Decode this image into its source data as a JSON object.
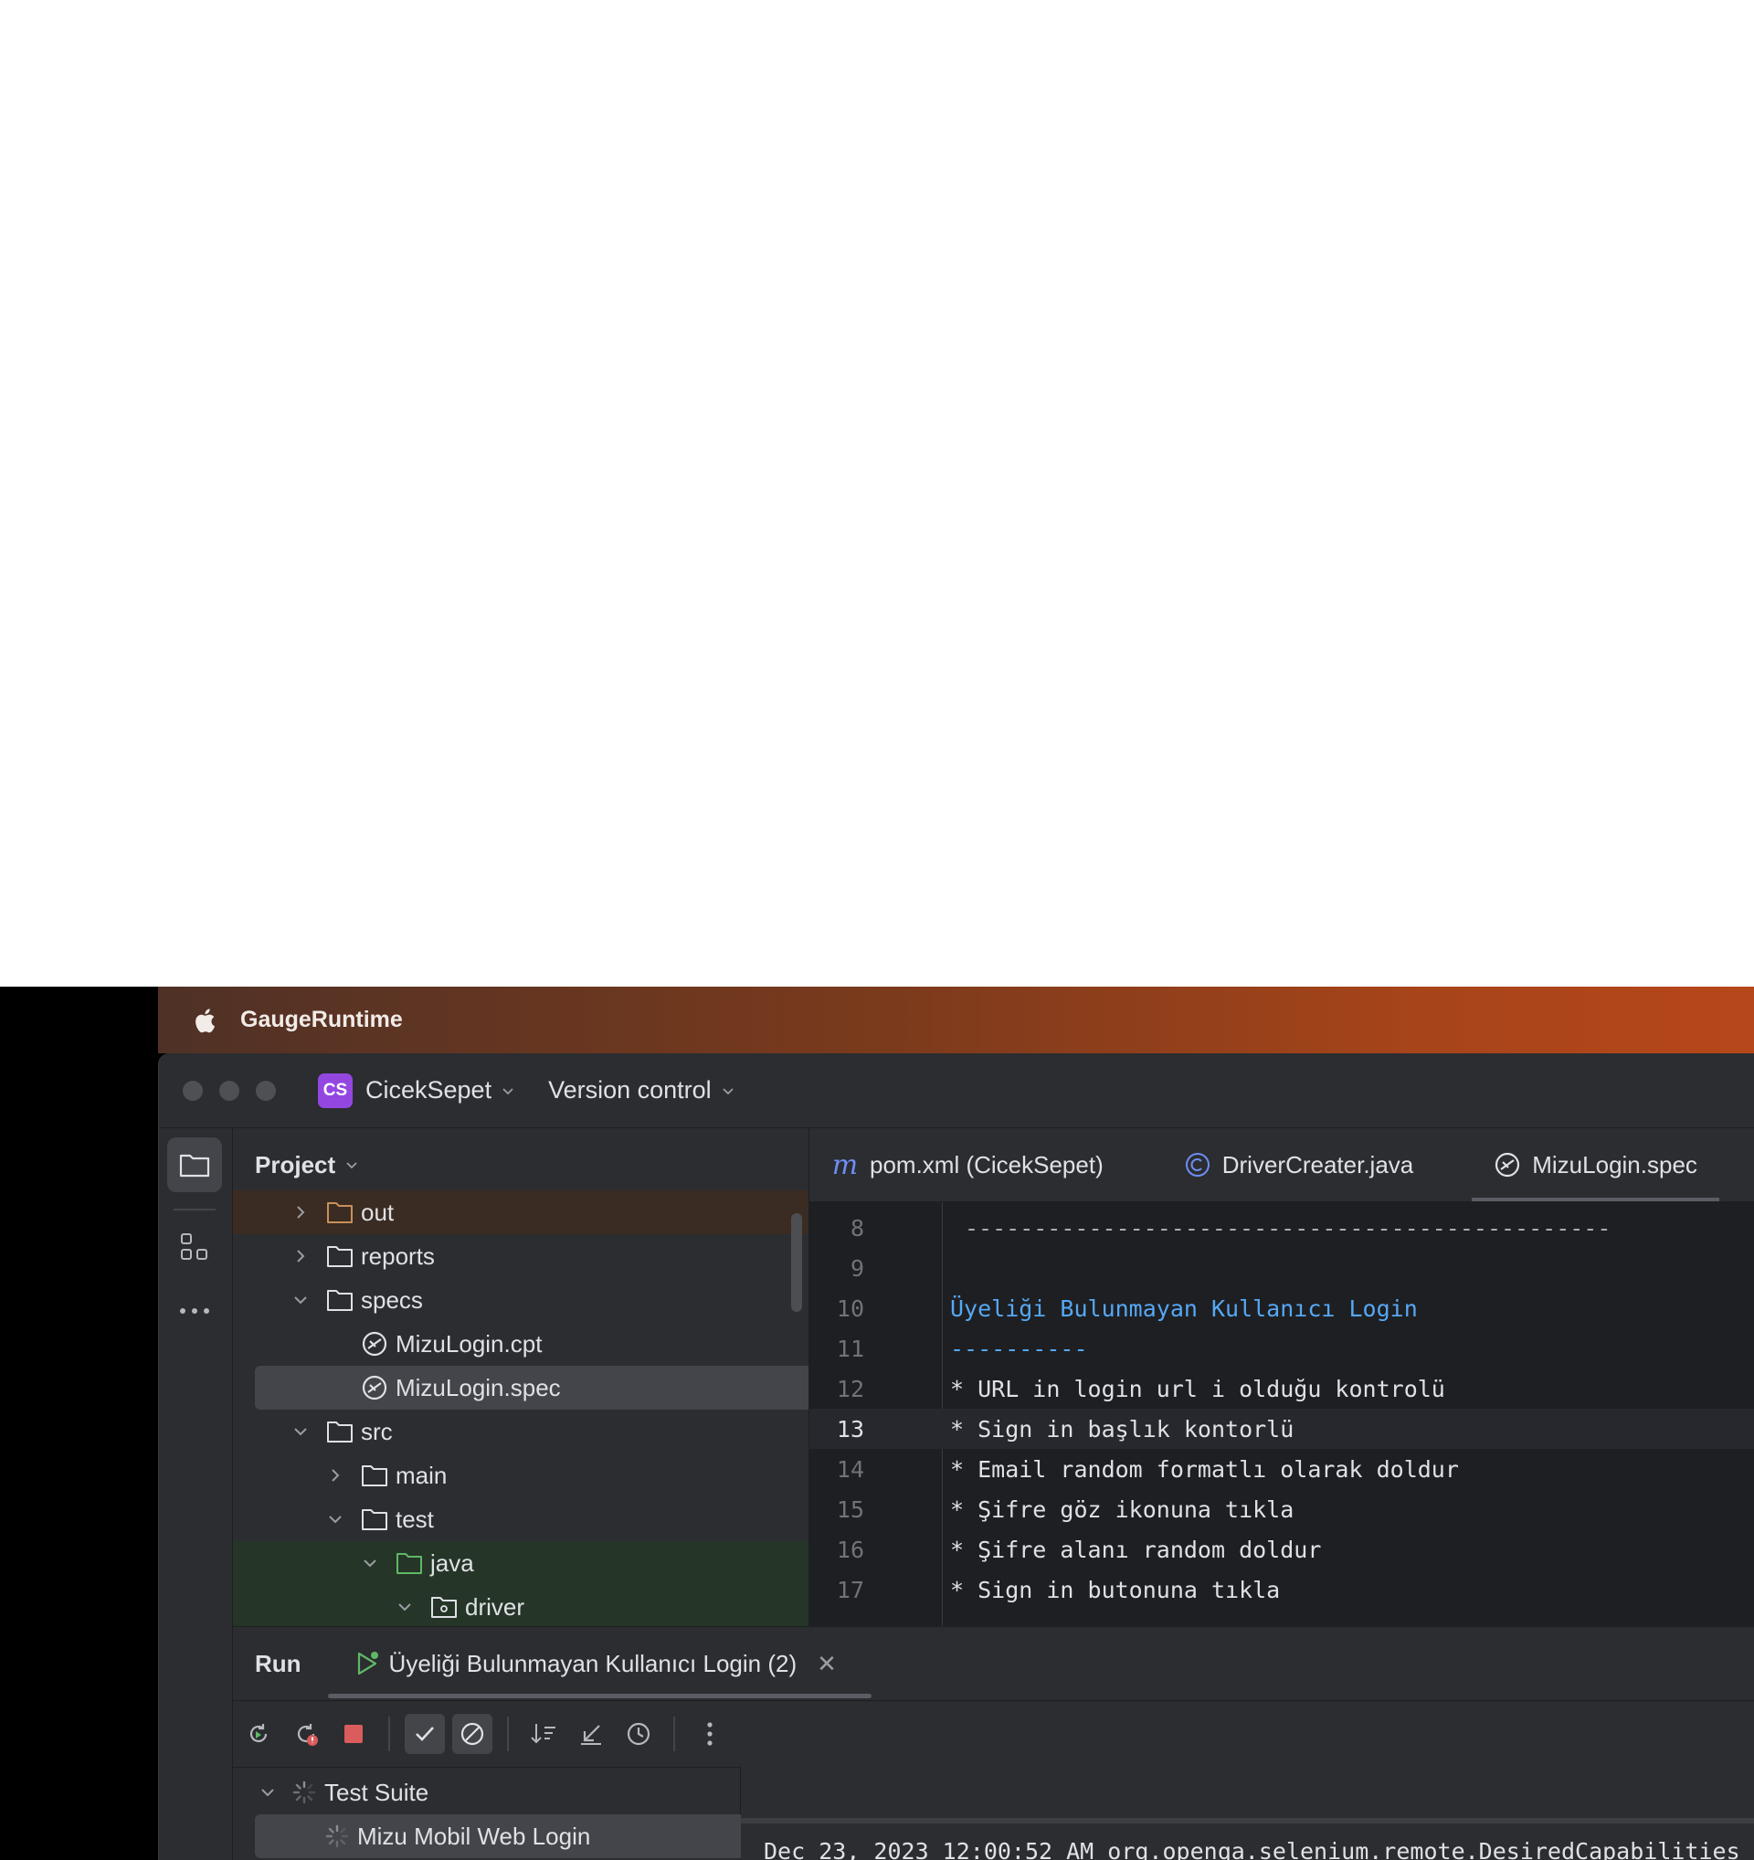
{
  "menubar": {
    "app_name": "GaugeRuntime"
  },
  "titlebar": {
    "project_badge": "CS",
    "project_name": "CicekSepet",
    "version_control": "Version control"
  },
  "project_panel": {
    "title": "Project",
    "items": [
      {
        "label": "out"
      },
      {
        "label": "reports"
      },
      {
        "label": "specs"
      },
      {
        "label": "MizuLogin.cpt"
      },
      {
        "label": "MizuLogin.spec"
      },
      {
        "label": "src"
      },
      {
        "label": "main"
      },
      {
        "label": "test"
      },
      {
        "label": "java"
      },
      {
        "label": "driver"
      }
    ]
  },
  "editor": {
    "tabs": [
      {
        "icon": "maven-m-icon",
        "label": "pom.xml (CicekSepet)"
      },
      {
        "icon": "java-class-icon",
        "label": "DriverCreater.java"
      },
      {
        "icon": "gauge-spec-icon",
        "label": "MizuLogin.spec"
      }
    ],
    "lines": [
      {
        "num": "8",
        "text": "-----------------------------------------------"
      },
      {
        "num": "9",
        "text": ""
      },
      {
        "num": "10",
        "text": "Üyeliği Bulunmayan Kullanıcı Login"
      },
      {
        "num": "11",
        "text": "----------"
      },
      {
        "num": "12",
        "text": "* URL in login url i olduğu kontrolü"
      },
      {
        "num": "13",
        "text": "* Sign in başlık kontorlü"
      },
      {
        "num": "14",
        "text": "* Email random formatlı olarak doldur"
      },
      {
        "num": "15",
        "text": "* Şifre göz ikonuna tıkla"
      },
      {
        "num": "16",
        "text": "* Şifre alanı random doldur"
      },
      {
        "num": "17",
        "text": "* Sign in butonuna tıkla"
      }
    ]
  },
  "run_panel": {
    "title": "Run",
    "tab_label": "Üyeliği Bulunmayan Kullanıcı Login (2)",
    "tree": [
      {
        "label": "Test Suite"
      },
      {
        "label": "Mizu Mobil Web Login"
      }
    ],
    "console_line": "Dec 23, 2023 12:00:52 AM org.openqa.selenium.remote.DesiredCapabilities"
  },
  "colors": {
    "accent": "#56a8f5",
    "badge": "#9447e0",
    "stop": "#db5c5c",
    "run_green": "#5fb865"
  }
}
